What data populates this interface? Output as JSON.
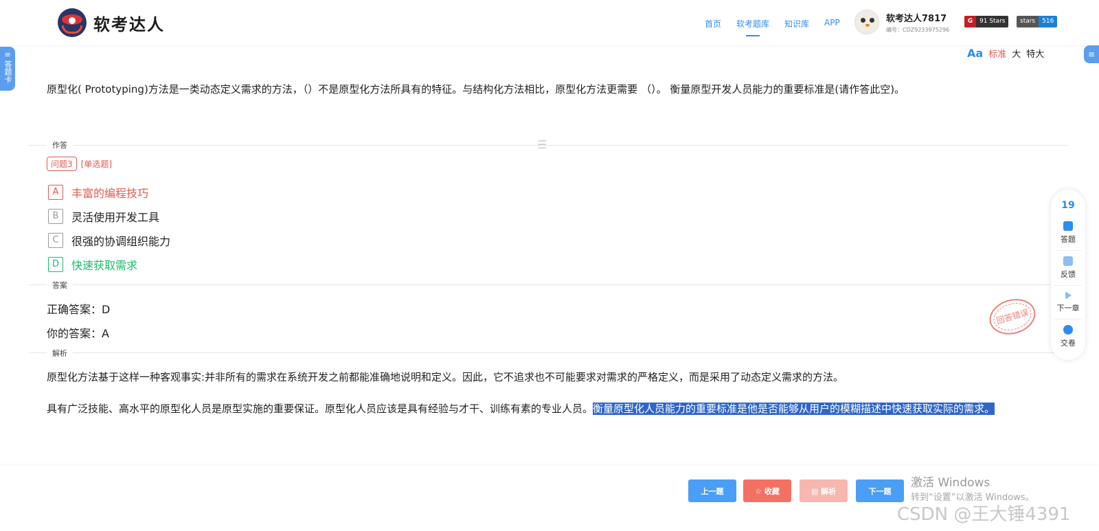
{
  "brand": {
    "name": "软考达人"
  },
  "nav": {
    "items": [
      "首页",
      "软考题库",
      "知识库",
      "APP"
    ],
    "active": "软考题库"
  },
  "user": {
    "name": "软考达人7817",
    "id_text": "编号：CDZ9233975296"
  },
  "badges": {
    "gitee_icon": "G",
    "gitee_text": "91 Stars",
    "github_text": "stars",
    "github_count": "516"
  },
  "side": {
    "left_tab": "答题卡",
    "right_tab": "≡",
    "left_icon": "≡"
  },
  "font_switch": {
    "icon": "Aa",
    "standard": "标准",
    "large": "大",
    "xlarge": "特大"
  },
  "question": {
    "text": "原型化( Prototyping)方法是一类动态定义需求的方法，（）不是原型化方法所具有的特征。与结构化方法相比，原型化方法更需要 （）。 衡量原型开发人员能力的重要标准是(请作答此空)。"
  },
  "sections": {
    "answer_area": "作答",
    "answer": "答案",
    "analysis": "解析"
  },
  "qtag": {
    "number": "问题3",
    "type": "[单选题]"
  },
  "options": [
    {
      "letter": "A",
      "text": "丰富的编程技巧",
      "state": "wrong"
    },
    {
      "letter": "B",
      "text": "灵活使用开发工具",
      "state": "normal"
    },
    {
      "letter": "C",
      "text": "很强的协调组织能力",
      "state": "normal"
    },
    {
      "letter": "D",
      "text": "快速获取需求",
      "state": "right"
    }
  ],
  "answer": {
    "correct": "正确答案：D",
    "yours": "你的答案：A"
  },
  "stamp": {
    "text": "回答错误"
  },
  "analysis": {
    "p1": "原型化方法基于这样一种客观事实:并非所有的需求在系统开发之前都能准确地说明和定义。因此，它不追求也不可能要求对需求的严格定义，而是采用了动态定义需求的方法。",
    "p2_plain": "具有广泛技能、高水平的原型化人员是原型实施的重要保证。原型化人员应该是具有经验与才干、训练有素的专业人员。",
    "p2_highlight": "衡量原型化人员能力的重要标准是他是否能够从用户的模糊描述中快速获取实际的需求。"
  },
  "float_panel": {
    "count": "19",
    "items": [
      {
        "icon": "answer-icon",
        "label": "答题"
      },
      {
        "icon": "feedback-icon",
        "label": "反馈"
      },
      {
        "icon": "next-chapter-icon",
        "label": "下一章"
      },
      {
        "icon": "submit-icon",
        "label": "交卷"
      }
    ]
  },
  "buttons": {
    "prev": "上一题",
    "favorite": "☆ 收藏",
    "analysis": "▤ 解析",
    "next": "下一题"
  },
  "watermarks": {
    "windows_line1": "激活 Windows",
    "windows_line2": "转到“设置”以激活 Windows。",
    "csdn": "CSDN @王大锤4391"
  },
  "colors": {
    "accent": "#2d8cf0",
    "wrong": "#e8584e",
    "right": "#19be6b",
    "highlight": "#2e66c9"
  }
}
